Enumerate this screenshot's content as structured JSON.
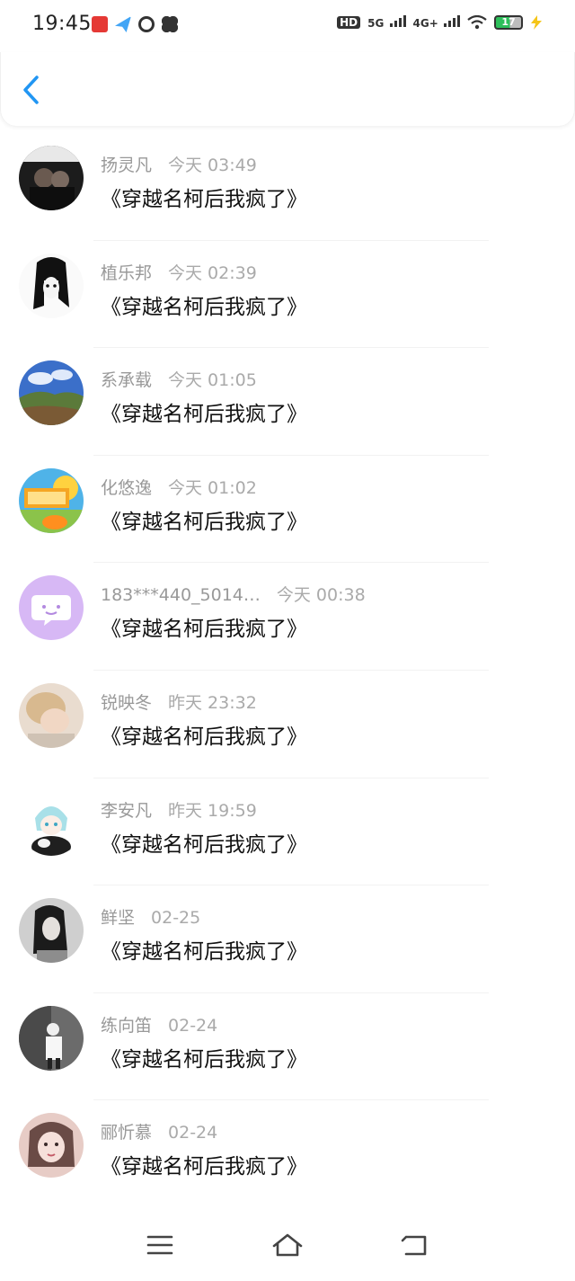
{
  "status_bar": {
    "time": "19:45",
    "hd_label": "HD",
    "net1": "5G",
    "net2": "4G+",
    "battery": "17",
    "app_icons": [
      "red-app-icon",
      "blue-app-icon",
      "ring-app-icon",
      "petal-app-icon"
    ]
  },
  "header": {
    "back_icon": "chevron-left-icon"
  },
  "messages": [
    {
      "name": "扬灵凡",
      "time": "今天 03:49",
      "text": "《穿越名柯后我疯了》"
    },
    {
      "name": "植乐邦",
      "time": "今天 02:39",
      "text": "《穿越名柯后我疯了》"
    },
    {
      "name": "系承载",
      "time": "今天 01:05",
      "text": "《穿越名柯后我疯了》"
    },
    {
      "name": "化悠逸",
      "time": "今天 01:02",
      "text": "《穿越名柯后我疯了》"
    },
    {
      "name": "183***440_5014…",
      "time": "今天 00:38",
      "text": "《穿越名柯后我疯了》"
    },
    {
      "name": "锐映冬",
      "time": "昨天 23:32",
      "text": "《穿越名柯后我疯了》"
    },
    {
      "name": "李安凡",
      "time": "昨天 19:59",
      "text": "《穿越名柯后我疯了》"
    },
    {
      "name": "鲜坚",
      "time": "02-25",
      "text": "《穿越名柯后我疯了》"
    },
    {
      "name": "练向笛",
      "time": "02-24",
      "text": "《穿越名柯后我疯了》"
    },
    {
      "name": "郦忻慕",
      "time": "02-24",
      "text": "《穿越名柯后我疯了》"
    }
  ],
  "nav": {
    "menu_icon": "menu-icon",
    "home_icon": "home-icon",
    "back_icon": "back-icon"
  },
  "colors": {
    "accent": "#2196f3",
    "name_text": "#999999",
    "message_text": "#111111"
  }
}
